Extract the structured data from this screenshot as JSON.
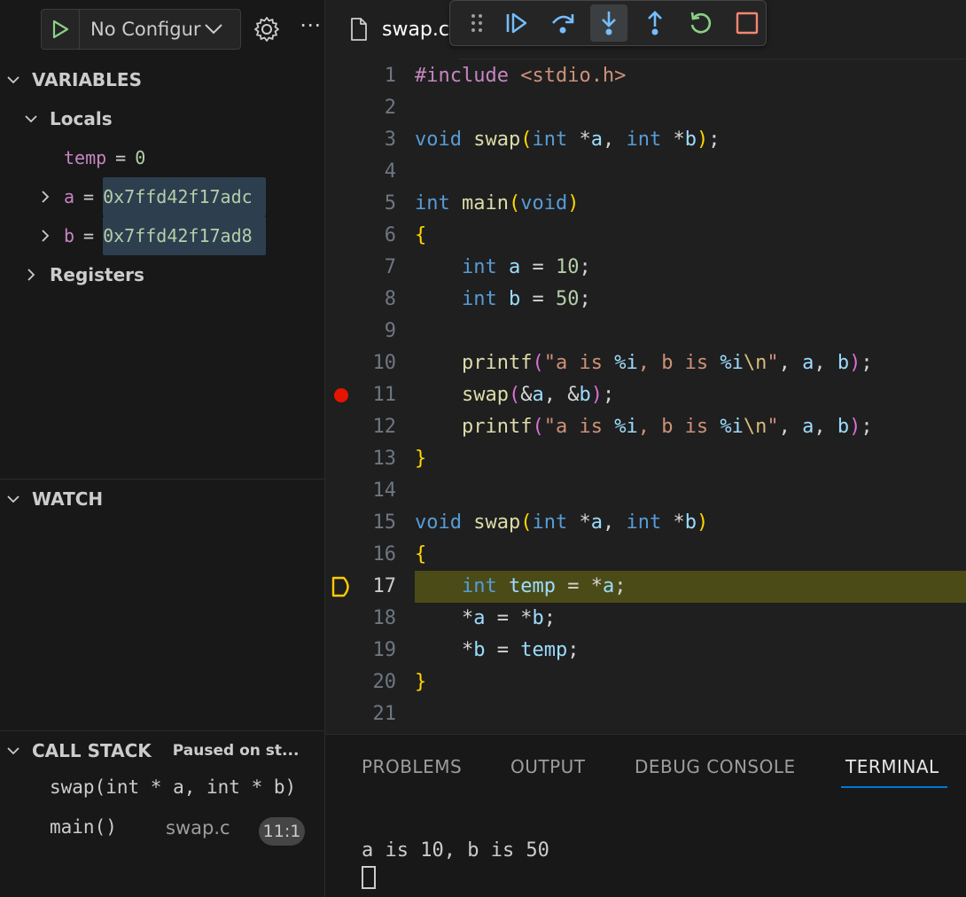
{
  "debug": {
    "config_label": "No Configur"
  },
  "variables": {
    "header": "VARIABLES",
    "locals_label": "Locals",
    "temp": {
      "name": "temp",
      "value": "0"
    },
    "a": {
      "name": "a",
      "value": "0x7ffd42f17adc"
    },
    "b": {
      "name": "b",
      "value": "0x7ffd42f17ad8"
    },
    "registers_label": "Registers"
  },
  "watch": {
    "header": "WATCH"
  },
  "call_stack": {
    "header": "CALL STACK",
    "status": "Paused on st...",
    "frames": [
      {
        "name": "swap(int * a, int * b)"
      },
      {
        "name": "main()",
        "file": "swap.c",
        "badge": "11:1"
      }
    ]
  },
  "editor": {
    "tab_name": "swap.c",
    "current_line": 17,
    "breakpoint_line": 11,
    "lines": [
      {
        "n": "1"
      },
      {
        "n": "2"
      },
      {
        "n": "3"
      },
      {
        "n": "4"
      },
      {
        "n": "5"
      },
      {
        "n": "6"
      },
      {
        "n": "7"
      },
      {
        "n": "8"
      },
      {
        "n": "9"
      },
      {
        "n": "10"
      },
      {
        "n": "11"
      },
      {
        "n": "12"
      },
      {
        "n": "13"
      },
      {
        "n": "14"
      },
      {
        "n": "15"
      },
      {
        "n": "16"
      },
      {
        "n": "17"
      },
      {
        "n": "18"
      },
      {
        "n": "19"
      },
      {
        "n": "20"
      },
      {
        "n": "21"
      }
    ],
    "code": {
      "l1_include": "#include",
      "l1_header": "<stdio.h>",
      "void": "void",
      "int": "int",
      "swap": "swap",
      "main": "main",
      "printf": "printf",
      "str_a": "\"a is ",
      "fmt_i": "%i",
      "str_mid": ", b is ",
      "esc_n": "\\n",
      "str_end": "\"",
      "n10": "10",
      "n50": "50"
    }
  },
  "panel": {
    "tabs": [
      {
        "label": "PROBLEMS"
      },
      {
        "label": "OUTPUT"
      },
      {
        "label": "DEBUG CONSOLE"
      },
      {
        "label": "TERMINAL"
      }
    ],
    "active_tab": "TERMINAL",
    "terminal_output": "a is 10, b is 50"
  },
  "colors": {
    "accent": "#0078d4",
    "breakpoint": "#e51400",
    "current_line": "#4b4b18",
    "continue_icon": "#75beff",
    "restart_icon": "#89d185",
    "stop_icon": "#f48771"
  }
}
